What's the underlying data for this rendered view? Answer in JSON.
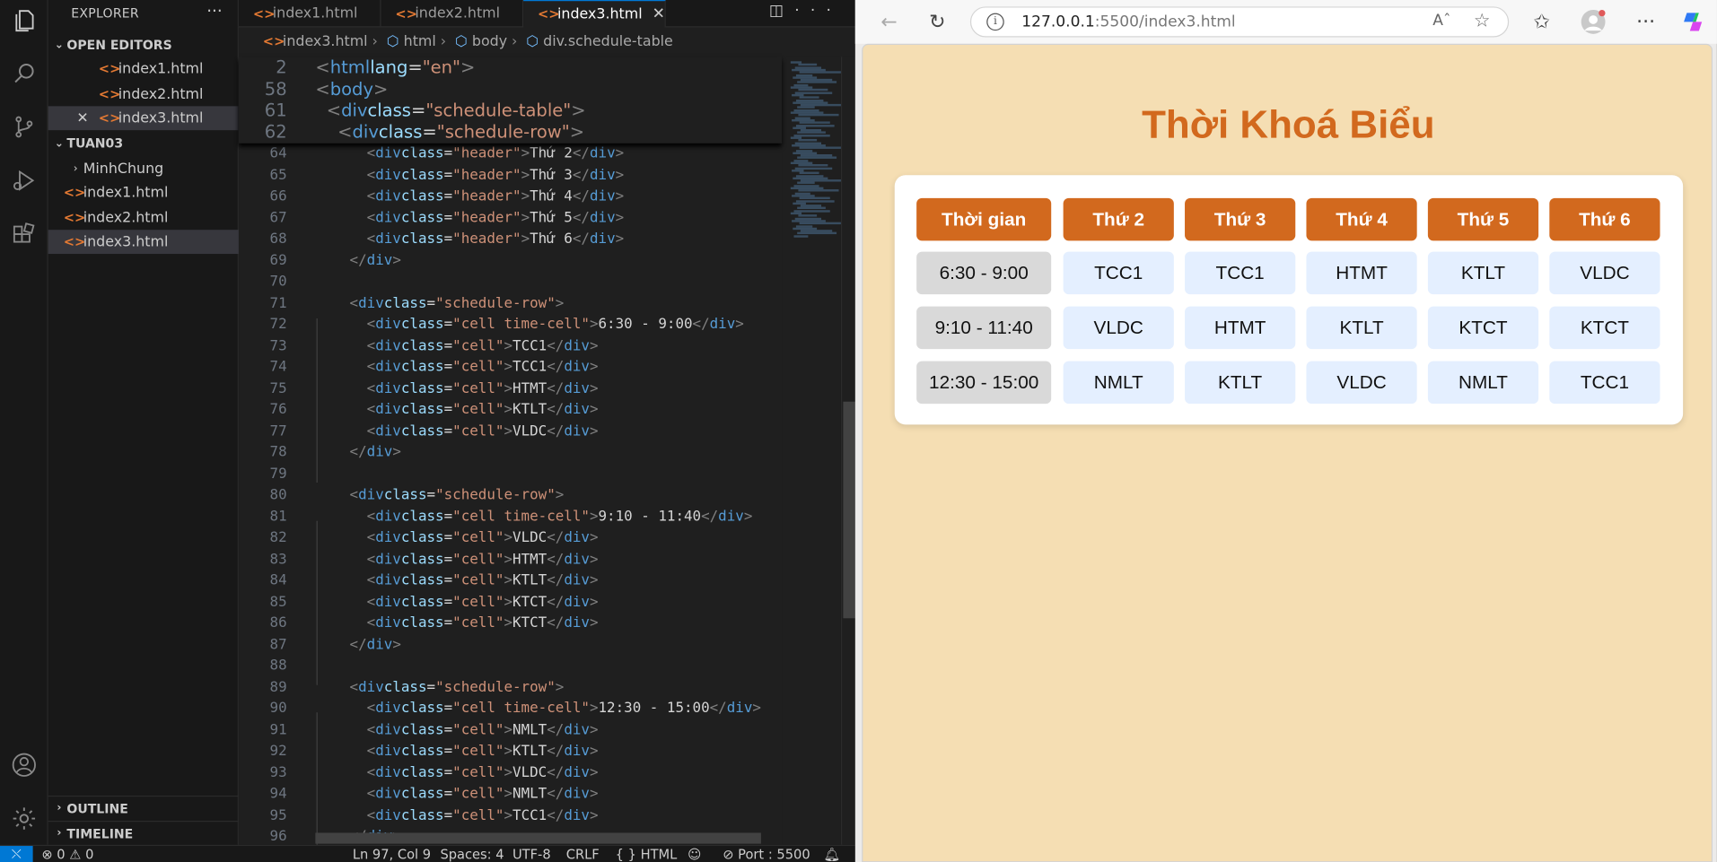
{
  "vscode": {
    "explorer": {
      "title": "EXPLORER",
      "open_editors_label": "OPEN EDITORS",
      "open_editors": [
        "index1.html",
        "index2.html",
        "index3.html"
      ],
      "folder_label": "TUAN03",
      "folder_items": [
        "MinhChung",
        "index1.html",
        "index2.html",
        "index3.html"
      ],
      "outline_label": "OUTLINE",
      "timeline_label": "TIMELINE"
    },
    "tabs": [
      "index1.html",
      "index2.html",
      "index3.html"
    ],
    "breadcrumb": [
      "index3.html",
      "html",
      "body",
      "div.schedule-table"
    ],
    "sticky_lines": [
      {
        "n": "2",
        "t": "<html lang=\"en\">"
      },
      {
        "n": "58",
        "t": "<body>"
      },
      {
        "n": "61",
        "t": "  <div class=\"schedule-table\">"
      },
      {
        "n": "62",
        "t": "    <div class=\"schedule-row\">"
      }
    ],
    "code_lines": [
      {
        "n": "64",
        "t": "      <div class=\"header\">Thứ 2</div>"
      },
      {
        "n": "65",
        "t": "      <div class=\"header\">Thứ 3</div>"
      },
      {
        "n": "66",
        "t": "      <div class=\"header\">Thứ 4</div>"
      },
      {
        "n": "67",
        "t": "      <div class=\"header\">Thứ 5</div>"
      },
      {
        "n": "68",
        "t": "      <div class=\"header\">Thứ 6</div>"
      },
      {
        "n": "69",
        "t": "    </div>"
      },
      {
        "n": "70",
        "t": ""
      },
      {
        "n": "71",
        "t": "    <div class=\"schedule-row\">"
      },
      {
        "n": "72",
        "t": "      <div class=\"cell time-cell\">6:30 - 9:00</div>"
      },
      {
        "n": "73",
        "t": "      <div class=\"cell\">TCC1</div>"
      },
      {
        "n": "74",
        "t": "      <div class=\"cell\">TCC1</div>"
      },
      {
        "n": "75",
        "t": "      <div class=\"cell\">HTMT</div>"
      },
      {
        "n": "76",
        "t": "      <div class=\"cell\">KTLT</div>"
      },
      {
        "n": "77",
        "t": "      <div class=\"cell\">VLDC</div>"
      },
      {
        "n": "78",
        "t": "    </div>"
      },
      {
        "n": "79",
        "t": ""
      },
      {
        "n": "80",
        "t": "    <div class=\"schedule-row\">"
      },
      {
        "n": "81",
        "t": "      <div class=\"cell time-cell\">9:10 - 11:40</div>"
      },
      {
        "n": "82",
        "t": "      <div class=\"cell\">VLDC</div>"
      },
      {
        "n": "83",
        "t": "      <div class=\"cell\">HTMT</div>"
      },
      {
        "n": "84",
        "t": "      <div class=\"cell\">KTLT</div>"
      },
      {
        "n": "85",
        "t": "      <div class=\"cell\">KTCT</div>"
      },
      {
        "n": "86",
        "t": "      <div class=\"cell\">KTCT</div>"
      },
      {
        "n": "87",
        "t": "    </div>"
      },
      {
        "n": "88",
        "t": ""
      },
      {
        "n": "89",
        "t": "    <div class=\"schedule-row\">"
      },
      {
        "n": "90",
        "t": "      <div class=\"cell time-cell\">12:30 - 15:00</div>"
      },
      {
        "n": "91",
        "t": "      <div class=\"cell\">NMLT</div>"
      },
      {
        "n": "92",
        "t": "      <div class=\"cell\">KTLT</div>"
      },
      {
        "n": "93",
        "t": "      <div class=\"cell\">VLDC</div>"
      },
      {
        "n": "94",
        "t": "      <div class=\"cell\">NMLT</div>"
      },
      {
        "n": "95",
        "t": "      <div class=\"cell\">TCC1</div>"
      },
      {
        "n": "96",
        "t": "    </div>"
      }
    ],
    "status": {
      "errors": "0",
      "warnings": "0",
      "position": "Ln 97, Col 9",
      "spaces": "Spaces: 4",
      "encoding": "UTF-8",
      "eol": "CRLF",
      "language": "HTML",
      "port": "Port : 5500"
    }
  },
  "browser": {
    "url_host": "127.0.0.1",
    "url_rest": ":5500/index3.html",
    "page_title": "Thời Khoá Biểu",
    "schedule": {
      "headers": [
        "Thời gian",
        "Thứ 2",
        "Thứ 3",
        "Thứ 4",
        "Thứ 5",
        "Thứ 6"
      ],
      "rows": [
        [
          "6:30 - 9:00",
          "TCC1",
          "TCC1",
          "HTMT",
          "KTLT",
          "VLDC"
        ],
        [
          "9:10 - 11:40",
          "VLDC",
          "HTMT",
          "KTLT",
          "KTCT",
          "KTCT"
        ],
        [
          "12:30 - 15:00",
          "NMLT",
          "KTLT",
          "VLDC",
          "NMLT",
          "TCC1"
        ]
      ]
    }
  },
  "colors": {
    "accent": "#d2691e",
    "page_bg": "#f5deb3",
    "cell_bg": "#e4efff",
    "time_cell_bg": "#d9d9d9",
    "vscode_blue": "#0078d4"
  }
}
